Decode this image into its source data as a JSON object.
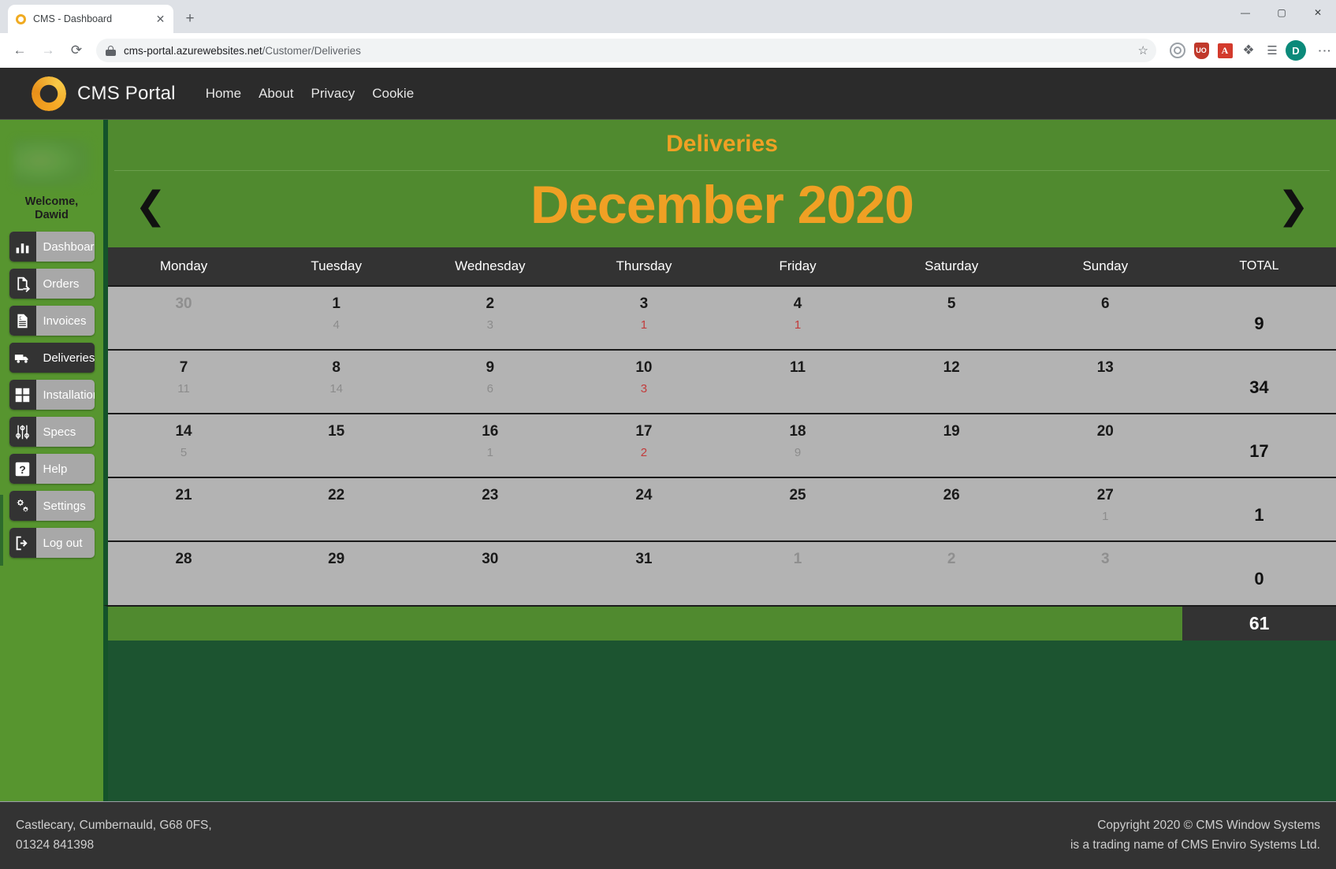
{
  "browser": {
    "tab_title": "CMS - Dashboard",
    "tab_close": "✕",
    "new_tab": "+",
    "window_minimize": "—",
    "window_maximize": "▢",
    "window_close": "✕",
    "back": "←",
    "forward": "→",
    "reload": "⟳",
    "url_host": "cms-portal.azurewebsites.net",
    "url_path": "/Customer/Deliveries",
    "bookmark_star": "☆",
    "ext_shield_label": "UO",
    "ext_pdf_label": "A",
    "ext_puzzle": "✦",
    "ext_list": "≡",
    "profile_initial": "D",
    "menu_kebab": "⋮"
  },
  "navbar": {
    "brand": "CMS Portal",
    "links": [
      {
        "label": "Home"
      },
      {
        "label": "About"
      },
      {
        "label": "Privacy"
      },
      {
        "label": "Cookie"
      }
    ]
  },
  "sidebar": {
    "welcome_line1": "Welcome,",
    "welcome_line2": "Dawid",
    "items": [
      {
        "label": "Dashboard",
        "icon": "bar-chart-icon",
        "active": false
      },
      {
        "label": "Orders",
        "icon": "order-doc-icon",
        "active": false
      },
      {
        "label": "Invoices",
        "icon": "invoice-icon",
        "active": false
      },
      {
        "label": "Deliveries",
        "icon": "truck-icon",
        "active": true
      },
      {
        "label": "Installations",
        "icon": "grid-tools-icon",
        "active": false
      },
      {
        "label": "Specs",
        "icon": "sliders-icon",
        "active": false
      },
      {
        "label": "Help",
        "icon": "question-icon",
        "active": false
      },
      {
        "label": "Settings",
        "icon": "gears-icon",
        "active": false
      },
      {
        "label": "Log out",
        "icon": "logout-icon",
        "active": false
      }
    ]
  },
  "calendar": {
    "section_title": "Deliveries",
    "month_label": "December 2020",
    "prev_arrow": "❮",
    "next_arrow": "❯",
    "headers": [
      "Monday",
      "Tuesday",
      "Wednesday",
      "Thursday",
      "Friday",
      "Saturday",
      "Sunday",
      "TOTAL"
    ],
    "grand_total": "61",
    "accent_color": "#f0a024",
    "green_color": "#7ede7e",
    "red_color": "#fc4f4f",
    "grey_color": "#b3b3b3",
    "weeks": [
      {
        "total": "9",
        "days": [
          {
            "num": "30",
            "count": "",
            "state": "grey",
            "other_month": true
          },
          {
            "num": "1",
            "count": "4",
            "state": "green",
            "other_month": false
          },
          {
            "num": "2",
            "count": "3",
            "state": "green",
            "other_month": false
          },
          {
            "num": "3",
            "count": "1",
            "state": "red",
            "other_month": false
          },
          {
            "num": "4",
            "count": "1",
            "state": "red",
            "other_month": false
          },
          {
            "num": "5",
            "count": "",
            "state": "grey",
            "other_month": false
          },
          {
            "num": "6",
            "count": "",
            "state": "grey",
            "other_month": false
          }
        ]
      },
      {
        "total": "34",
        "days": [
          {
            "num": "7",
            "count": "11",
            "state": "green",
            "other_month": false
          },
          {
            "num": "8",
            "count": "14",
            "state": "green",
            "other_month": false
          },
          {
            "num": "9",
            "count": "6",
            "state": "green",
            "other_month": false
          },
          {
            "num": "10",
            "count": "3",
            "state": "red",
            "other_month": false
          },
          {
            "num": "11",
            "count": "",
            "state": "grey",
            "other_month": false
          },
          {
            "num": "12",
            "count": "",
            "state": "grey",
            "other_month": false
          },
          {
            "num": "13",
            "count": "",
            "state": "grey",
            "other_month": false
          }
        ]
      },
      {
        "total": "17",
        "days": [
          {
            "num": "14",
            "count": "5",
            "state": "green",
            "other_month": false
          },
          {
            "num": "15",
            "count": "",
            "state": "grey",
            "other_month": false
          },
          {
            "num": "16",
            "count": "1",
            "state": "green",
            "other_month": false
          },
          {
            "num": "17",
            "count": "2",
            "state": "red",
            "other_month": false
          },
          {
            "num": "18",
            "count": "9",
            "state": "green",
            "other_month": false
          },
          {
            "num": "19",
            "count": "",
            "state": "grey",
            "other_month": false
          },
          {
            "num": "20",
            "count": "",
            "state": "grey",
            "other_month": false
          }
        ]
      },
      {
        "total": "1",
        "days": [
          {
            "num": "21",
            "count": "",
            "state": "grey",
            "other_month": false
          },
          {
            "num": "22",
            "count": "",
            "state": "grey",
            "other_month": false
          },
          {
            "num": "23",
            "count": "",
            "state": "grey",
            "other_month": false
          },
          {
            "num": "24",
            "count": "",
            "state": "grey",
            "other_month": false
          },
          {
            "num": "25",
            "count": "",
            "state": "grey",
            "other_month": false
          },
          {
            "num": "26",
            "count": "",
            "state": "grey",
            "other_month": false
          },
          {
            "num": "27",
            "count": "1",
            "state": "grey",
            "other_month": false
          }
        ]
      },
      {
        "total": "0",
        "days": [
          {
            "num": "28",
            "count": "",
            "state": "grey",
            "other_month": false
          },
          {
            "num": "29",
            "count": "",
            "state": "grey",
            "other_month": false
          },
          {
            "num": "30",
            "count": "",
            "state": "grey",
            "other_month": false
          },
          {
            "num": "31",
            "count": "",
            "state": "grey",
            "other_month": false
          },
          {
            "num": "1",
            "count": "",
            "state": "grey",
            "other_month": true
          },
          {
            "num": "2",
            "count": "",
            "state": "grey",
            "other_month": true
          },
          {
            "num": "3",
            "count": "",
            "state": "grey",
            "other_month": true
          }
        ]
      }
    ]
  },
  "footer": {
    "address_line1": "Castlecary, Cumbernauld, G68 0FS,",
    "address_line2": "01324 841398",
    "copyright_line1": "Copyright 2020 © CMS Window Systems",
    "copyright_line2": "is a trading name of CMS Enviro Systems Ltd."
  }
}
